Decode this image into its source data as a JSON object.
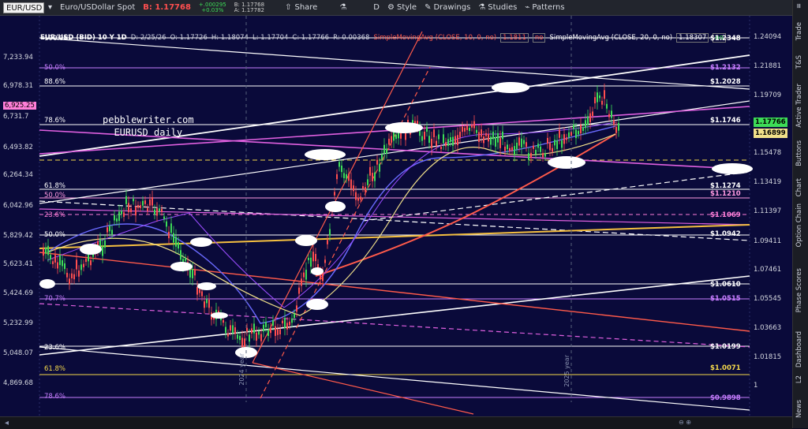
{
  "toolbar": {
    "symbol": "EUR/USD",
    "description": "Euro/USDollar Spot",
    "bid_label": "B: 1.17768",
    "change_abs": "+.000295",
    "change_pct": "+0.03%",
    "bid_small": "B: 1.17768",
    "ask_small": "A: 1.17782",
    "share": "Share",
    "period": "D",
    "style": "Style",
    "drawings": "Drawings",
    "studies": "Studies",
    "patterns": "Patterns"
  },
  "status": {
    "instrument": "EUR/USD (BID) 10 Y 1D",
    "date": "D: 2/25/26",
    "open": "O: 1.17726",
    "high": "H: 1.18074",
    "low": "L: 1.17704",
    "close": "C: 1.17766",
    "range": "R: 0.00368",
    "sma10_label": "SimpleMovingAvg (CLOSE, 10, 0, no)",
    "sma10_value": "1.1811",
    "sma10_no": "no",
    "sma20_label": "SimpleMovingAvg (CLOSE, 20, 0, no)",
    "sma20_value": "1.18307",
    "sma20_no": "no"
  },
  "watermark": {
    "line1": "pebblewriter.com",
    "line2": "EURUSD daily"
  },
  "left_axis": [
    "7,233.94",
    "6,978.31",
    "6,731.7",
    "6,493.82",
    "6,264.34",
    "6,042.96",
    "5,829.42",
    "5,623.41",
    "5,424.69",
    "5,232.99",
    "5,048.07",
    "4,869.68"
  ],
  "left_tag": "6,925.25",
  "right_axis": [
    "1.24094",
    "1.21881",
    "1.19709",
    "1.17576",
    "1.15478",
    "1.13419",
    "1.11397",
    "1.09411",
    "1.07461",
    "1.05545",
    "1.03663",
    "1.01815",
    "1"
  ],
  "fib_labels": [
    {
      "text": "100.0%",
      "color": "#ffffff"
    },
    {
      "text": "50.0%",
      "color": "#c77dff"
    },
    {
      "text": "88.6%",
      "color": "#ffffff"
    },
    {
      "text": "78.6%",
      "color": "#ffffff"
    },
    {
      "text": "61.8%",
      "color": "#ffffff"
    },
    {
      "text": "50.0%",
      "color": "#ff9ae0"
    },
    {
      "text": "23.6%",
      "color": "#ff7fd9"
    },
    {
      "text": "50.0%",
      "color": "#ffffff"
    },
    {
      "text": "2%",
      "color": "#ffffff"
    },
    {
      "text": "70.7%",
      "color": "#c77dff"
    },
    {
      "text": "23.6%",
      "color": "#ffffff"
    },
    {
      "text": "61.8%",
      "color": "#f5d94b"
    },
    {
      "text": "78.6%",
      "color": "#c77dff"
    }
  ],
  "levels": [
    {
      "text": "$1.2348",
      "color": "#ffffff"
    },
    {
      "text": "$1.2132",
      "color": "#c77dff"
    },
    {
      "text": "$1.2028",
      "color": "#ffffff"
    },
    {
      "text": "$1.1746",
      "color": "#ffffff"
    },
    {
      "text": "$1.1274",
      "color": "#ffffff"
    },
    {
      "text": "$1.1210",
      "color": "#ff9ae0"
    },
    {
      "text": "$1.1069",
      "color": "#ff7fd9"
    },
    {
      "text": "$1.0942",
      "color": "#ffffff"
    },
    {
      "text": "$1.0610",
      "color": "#ffffff"
    },
    {
      "text": "$1.0515",
      "color": "#c77dff"
    },
    {
      "text": "$1.0199",
      "color": "#ffffff"
    },
    {
      "text": "$1.0071",
      "color": "#f5d94b"
    },
    {
      "text": "$0.9898",
      "color": "#c77dff"
    }
  ],
  "price_tags": {
    "last": "1.17766",
    "sma": "1.16899"
  },
  "months": [
    "Jun",
    "Jul",
    "Aug",
    "Sep",
    "Oct",
    "Nov",
    "Dec",
    "25",
    "Feb",
    "Mar",
    "Apr",
    "May",
    "Jun",
    "Jul",
    "Aug",
    "Sep",
    "Oct",
    "Nov",
    "Dec",
    "26",
    "Feb",
    "Mar",
    "Apr",
    "May",
    "Jun",
    "Jul"
  ],
  "year_markers": [
    "2024 year",
    "2025 year"
  ],
  "side_tabs": [
    "Trade",
    "T&S",
    "Active Trader",
    "Buttons",
    "Chart",
    "Option Chain",
    "Phase Scores",
    "Dashboard",
    "L2",
    "News"
  ],
  "colors": {
    "background": "#0a0a3a",
    "up": "#3ddc57",
    "down": "#ff4f4f"
  }
}
